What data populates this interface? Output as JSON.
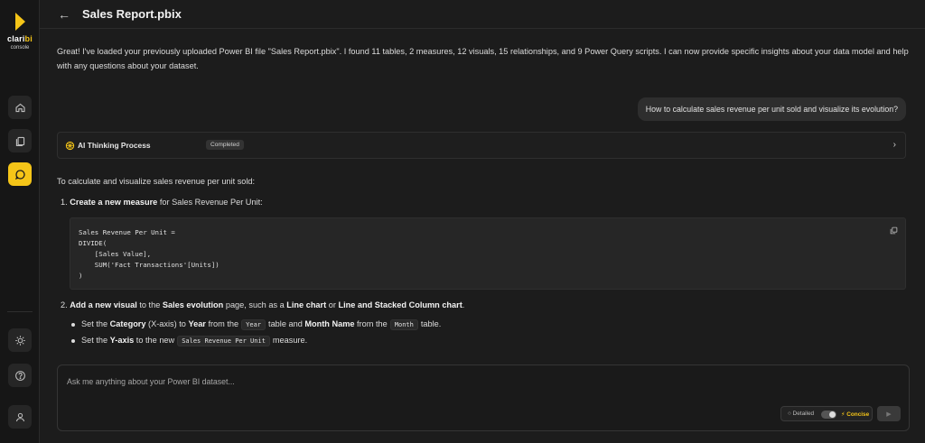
{
  "brand": {
    "name_prefix": "clari",
    "name_suffix": "bi",
    "sub": "console",
    "accent": "#f5c518"
  },
  "header": {
    "back_icon": "arrow-left-icon",
    "title": "Sales Report.pbix"
  },
  "sidebar": {
    "items": [
      {
        "name": "home",
        "icon": "home-icon"
      },
      {
        "name": "files",
        "icon": "files-icon"
      },
      {
        "name": "chat",
        "icon": "chat-icon",
        "active": true
      },
      {
        "name": "theme",
        "icon": "sun-icon"
      },
      {
        "name": "help",
        "icon": "help-icon"
      },
      {
        "name": "account",
        "icon": "user-icon"
      }
    ]
  },
  "chat": {
    "intro": "Great! I've loaded your previously uploaded Power BI file \"Sales Report.pbix\". I found 11 tables, 2 measures, 12 visuals, 15 relationships, and 9 Power Query scripts. I can now provide specific insights about your data model and help with any questions about your dataset.",
    "user_message": "How to calculate sales revenue per unit sold and visualize its evolution?",
    "thinking": {
      "label": "AI Thinking Process",
      "status": "Completed"
    },
    "answer": {
      "intro": "To calculate and visualize sales revenue per unit sold:",
      "step1": {
        "num": "1.",
        "bold": "Create a new measure",
        "rest": " for Sales Revenue Per Unit:"
      },
      "code": "Sales Revenue Per Unit =\nDIVIDE(\n    [Sales Value],\n    SUM('Fact Transactions'[Units])\n)",
      "step2": {
        "num": "2.",
        "bold1": "Add a new visual",
        "t1": " to the ",
        "bold2": "Sales evolution",
        "t2": " page, such as a ",
        "bold3": "Line chart",
        "t3": " or ",
        "bold4": "Line and Stacked Column chart",
        "t4": "."
      },
      "bullet1": {
        "t1": "Set the ",
        "bold1": "Category",
        "t2": " (X-axis) to ",
        "bold2": "Year",
        "t3": " from the",
        "chip1": "Year",
        "t4": "table and ",
        "bold3": "Month Name",
        "t5": " from the",
        "chip2": "Month",
        "t6": "table."
      },
      "bullet2": {
        "t1": "Set the ",
        "bold1": "Y-axis",
        "t2": " to the new",
        "chip1": "Sales Revenue Per Unit",
        "t3": "measure."
      }
    }
  },
  "composer": {
    "placeholder": "Ask me anything about your Power BI dataset...",
    "mode_detailed": "Detailed",
    "mode_concise": "Concise",
    "send_icon": "send-icon"
  }
}
